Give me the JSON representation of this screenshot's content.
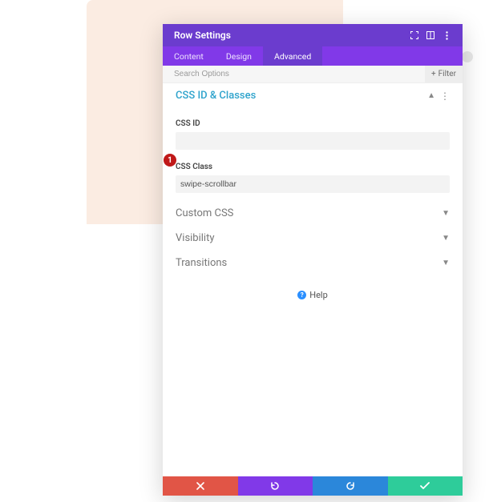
{
  "header": {
    "title": "Row Settings"
  },
  "tabs": {
    "content": "Content",
    "design": "Design",
    "advanced": "Advanced"
  },
  "search": {
    "placeholder": "Search Options",
    "filter_label": "Filter"
  },
  "sections": {
    "css": {
      "title": "CSS ID & Classes",
      "css_id_label": "CSS ID",
      "css_id_value": "",
      "css_class_label": "CSS Class",
      "css_class_value": "swipe-scrollbar"
    },
    "custom_css": {
      "title": "Custom CSS"
    },
    "visibility": {
      "title": "Visibility"
    },
    "transitions": {
      "title": "Transitions"
    }
  },
  "help": {
    "label": "Help"
  },
  "marker": {
    "label": "1"
  }
}
